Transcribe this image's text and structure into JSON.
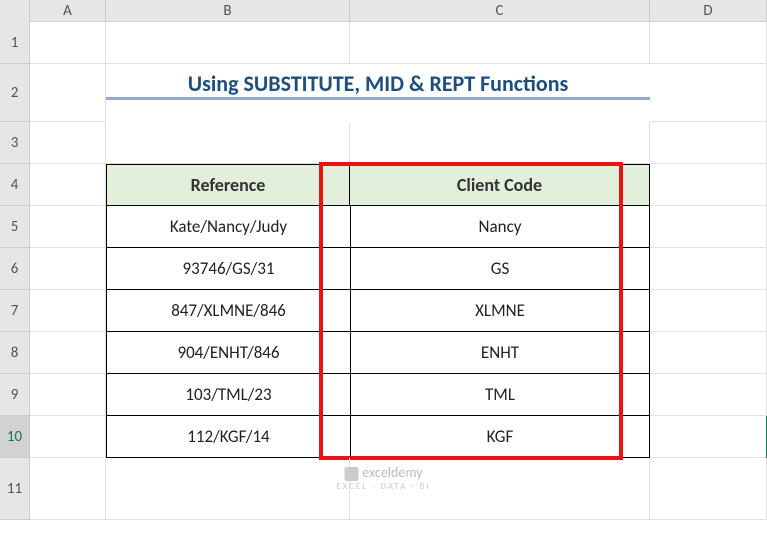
{
  "columns": [
    "A",
    "B",
    "C",
    "D"
  ],
  "rows": [
    "1",
    "2",
    "3",
    "4",
    "5",
    "6",
    "7",
    "8",
    "9",
    "10",
    "11"
  ],
  "title": "Using SUBSTITUTE, MID & REPT Functions",
  "table": {
    "headers": [
      "Reference",
      "Client Code"
    ],
    "data": [
      [
        "Kate/Nancy/Judy",
        "Nancy"
      ],
      [
        "93746/GS/31",
        "GS"
      ],
      [
        "847/XLMNE/846",
        "XLMNE"
      ],
      [
        "904/ENHT/846",
        "ENHT"
      ],
      [
        "103/TML/23",
        "TML"
      ],
      [
        "112/KGF/14",
        "KGF"
      ]
    ]
  },
  "watermark": "exceldemy",
  "selected_row": "10",
  "chart_data": {
    "type": "table",
    "title": "Using SUBSTITUTE, MID & REPT Functions",
    "columns": [
      "Reference",
      "Client Code"
    ],
    "rows": [
      {
        "Reference": "Kate/Nancy/Judy",
        "Client Code": "Nancy"
      },
      {
        "Reference": "93746/GS/31",
        "Client Code": "GS"
      },
      {
        "Reference": "847/XLMNE/846",
        "Client Code": "XLMNE"
      },
      {
        "Reference": "904/ENHT/846",
        "Client Code": "ENHT"
      },
      {
        "Reference": "103/TML/23",
        "Client Code": "TML"
      },
      {
        "Reference": "112/KGF/14",
        "Client Code": "KGF"
      }
    ]
  }
}
